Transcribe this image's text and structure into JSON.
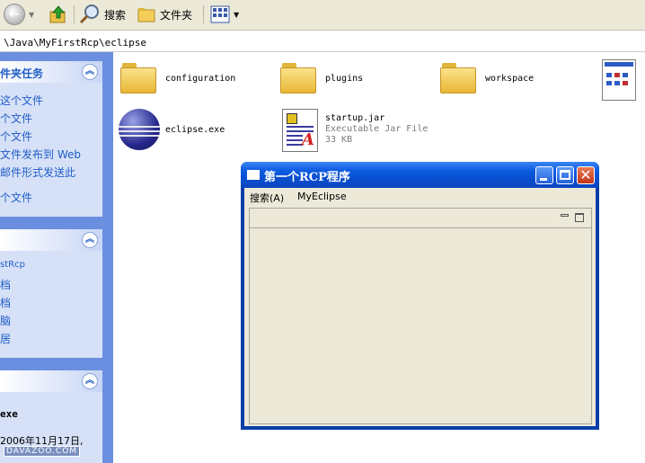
{
  "toolbar": {
    "search_label": "搜索",
    "folders_label": "文件夹"
  },
  "address": {
    "path": "\\Java\\MyFirstRcp\\eclipse"
  },
  "left": {
    "tasks_title": "件夹任务",
    "tasks": [
      "这个文件",
      "个文件",
      "个文件",
      "文件发布到 Web",
      "邮件形式发送此",
      "个文件"
    ],
    "places": [
      "stRcp",
      "档",
      "档",
      "脑",
      "居"
    ],
    "details_title": "exe",
    "details_date": " 2006年11月17日,",
    "watermark": "DAVAZOO.COM"
  },
  "files": [
    {
      "name": "configuration",
      "type": "folder"
    },
    {
      "name": "plugins",
      "type": "folder"
    },
    {
      "name": "workspace",
      "type": "folder"
    },
    {
      "name": "",
      "type": "grid-file"
    },
    {
      "name": "eclipse.exe",
      "type": "eclipse-app"
    },
    {
      "name": "startup.jar",
      "type": "jar-file",
      "desc": "Executable Jar File",
      "size": "33 KB"
    }
  ],
  "rcp_window": {
    "title": "第一个RCP程序",
    "menus": [
      "搜索(A)",
      "MyEclipse"
    ]
  },
  "icons": {
    "back": "back-arrow-icon",
    "up": "up-folder-icon",
    "search": "search-magnifier-icon",
    "folders": "folders-icon",
    "views": "views-grid-icon"
  },
  "colors": {
    "xp_blue": "#0a4dcc",
    "task_link": "#215dc6",
    "left_pane": "#6b8fe0"
  }
}
